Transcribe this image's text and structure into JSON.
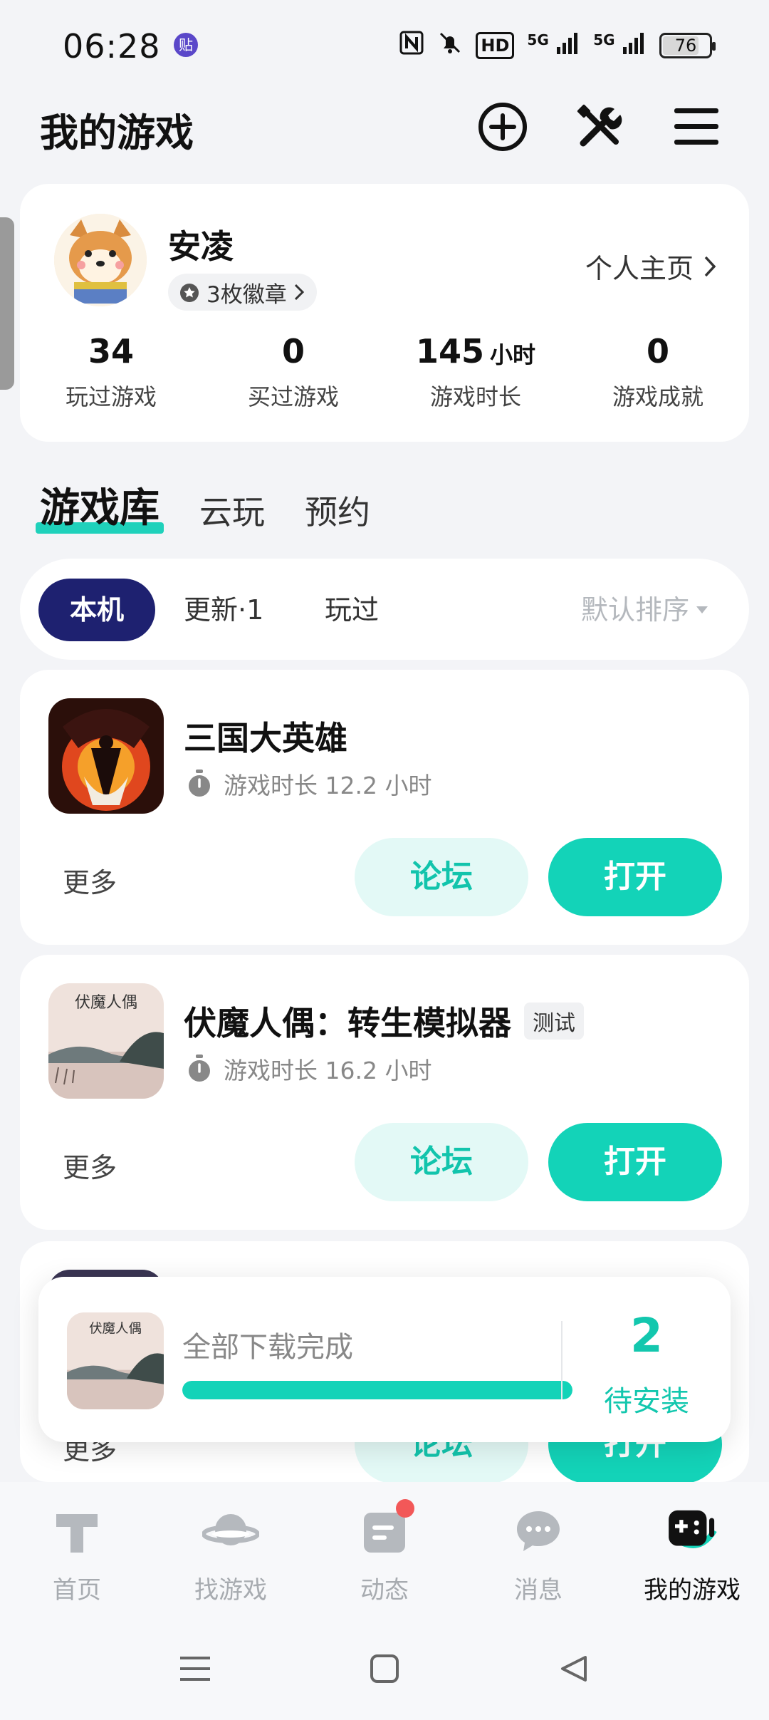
{
  "status_bar": {
    "time": "06:28",
    "notification_badge": "贴",
    "icons": [
      "nfc-icon",
      "mute-icon",
      "hd-icon",
      "signal-5g-icon",
      "signal-5g-icon"
    ],
    "hd_label": "HD",
    "net_label_1": "5G",
    "net_label_2": "5G",
    "battery": "76"
  },
  "header": {
    "title": "我的游戏",
    "actions": [
      "add-icon",
      "tools-icon",
      "menu-icon"
    ]
  },
  "profile": {
    "username": "安凌",
    "badges": "3枚徽章",
    "homepage_link": "个人主页",
    "stats": [
      {
        "value": "34",
        "unit": "",
        "label": "玩过游戏"
      },
      {
        "value": "0",
        "unit": "",
        "label": "买过游戏"
      },
      {
        "value": "145",
        "unit": "小时",
        "label": "游戏时长"
      },
      {
        "value": "0",
        "unit": "",
        "label": "游戏成就"
      }
    ]
  },
  "main_tabs": [
    {
      "label": "游戏库",
      "active": true
    },
    {
      "label": "云玩",
      "active": false
    },
    {
      "label": "预约",
      "active": false
    }
  ],
  "filters": {
    "chips": [
      "本机",
      "更新·1",
      "玩过"
    ],
    "active": "本机",
    "sort": "默认排序"
  },
  "games": [
    {
      "name": "三国大英雄",
      "tag": "",
      "playtime": "游戏时长 12.2 小时",
      "more": "更多",
      "forum": "论坛",
      "open": "打开"
    },
    {
      "name": "伏魔人偶：转生模拟器",
      "tag": "测试",
      "playtime": "游戏时长 16.2 小时",
      "more": "更多",
      "forum": "论坛",
      "open": "打开"
    },
    {
      "name": "",
      "tag": "",
      "playtime": "",
      "more": "更多",
      "forum": "论坛",
      "open": "打开"
    }
  ],
  "game_icon_text": "伏魔人偶",
  "download": {
    "status": "全部下载完成",
    "progress": 1.0,
    "count": "2",
    "label": "待安装"
  },
  "bottom_nav": [
    {
      "label": "首页",
      "icon": "home-icon",
      "active": false
    },
    {
      "label": "找游戏",
      "icon": "planet-icon",
      "active": false
    },
    {
      "label": "动态",
      "icon": "feed-icon",
      "active": false,
      "dot": true
    },
    {
      "label": "消息",
      "icon": "chat-icon",
      "active": false
    },
    {
      "label": "我的游戏",
      "icon": "gamepad-icon",
      "active": true
    }
  ],
  "colors": {
    "accent": "#13d3b8",
    "accent_light": "#e3f9f6",
    "chip_active": "#1e2170",
    "background": "#f3f4f7"
  }
}
